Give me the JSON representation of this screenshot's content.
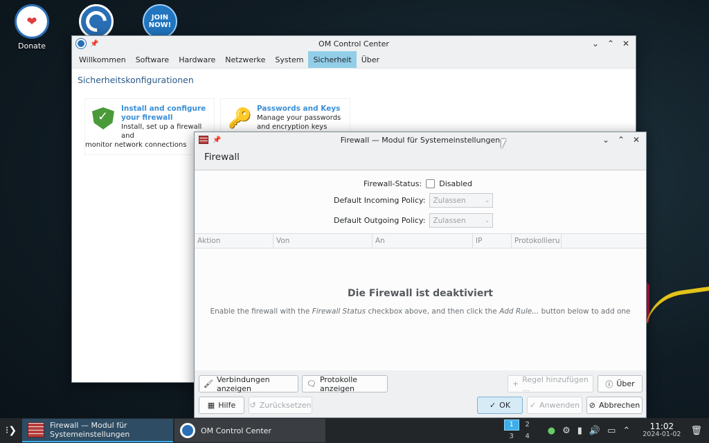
{
  "desktop": {
    "icons": [
      {
        "label": "Donate"
      },
      {
        "label": ""
      },
      {
        "label": "",
        "badge": "JOIN NOW!"
      }
    ]
  },
  "om_window": {
    "title": "OM Control Center",
    "tabs": [
      "Willkommen",
      "Software",
      "Hardware",
      "Netzwerke",
      "System",
      "Sicherheit",
      "Über"
    ],
    "active_tab": "Sicherheit",
    "heading": "Sicherheitskonfigurationen",
    "cards": [
      {
        "title_line1": "Install and configure",
        "title_line2": "your firewall",
        "desc_line1": "Install, set up a firewall and",
        "desc_line2": "monitor network connections",
        "icon": "shield-check-icon"
      },
      {
        "title_line1": "Passwords and Keys",
        "title_line2": "",
        "desc_line1": "Manage your passwords",
        "desc_line2": "and encryption keys",
        "icon": "keys-icon"
      }
    ]
  },
  "fw_window": {
    "title": "Firewall — Modul für Systemeinstellungen",
    "header": "Firewall",
    "status_label": "Firewall-Status:",
    "status_value": "Disabled",
    "incoming_label": "Default Incoming Policy:",
    "incoming_value": "Zulassen",
    "outgoing_label": "Default Outgoing Policy:",
    "outgoing_value": "Zulassen",
    "columns": [
      "Aktion",
      "Von",
      "An",
      "IP",
      "Protokollieru"
    ],
    "empty_title": "Die Firewall ist deaktiviert",
    "empty_msg_part1": "Enable the firewall with the ",
    "empty_msg_em1": "Firewall Status",
    "empty_msg_part2": " checkbox above, and then click the ",
    "empty_msg_em2": "Add Rule...",
    "empty_msg_part3": " button below to add one",
    "buttons": {
      "connections": "Verbindungen anzeigen",
      "logs": "Protokolle anzeigen",
      "add_rule": "Regel hinzufügen ...",
      "about": "Über",
      "help": "Hilfe",
      "reset": "Zurücksetzen",
      "ok": "OK",
      "apply": "Anwenden",
      "cancel": "Abbrechen"
    }
  },
  "taskbar": {
    "tasks": [
      {
        "label_line1": "Firewall — Modul für",
        "label_line2": "Systemeinstellungen"
      },
      {
        "label_line1": "OM Control Center",
        "label_line2": ""
      }
    ],
    "pager": [
      "1",
      "2",
      "3",
      "4"
    ],
    "time": "11:02",
    "date": "2024-01-02"
  }
}
